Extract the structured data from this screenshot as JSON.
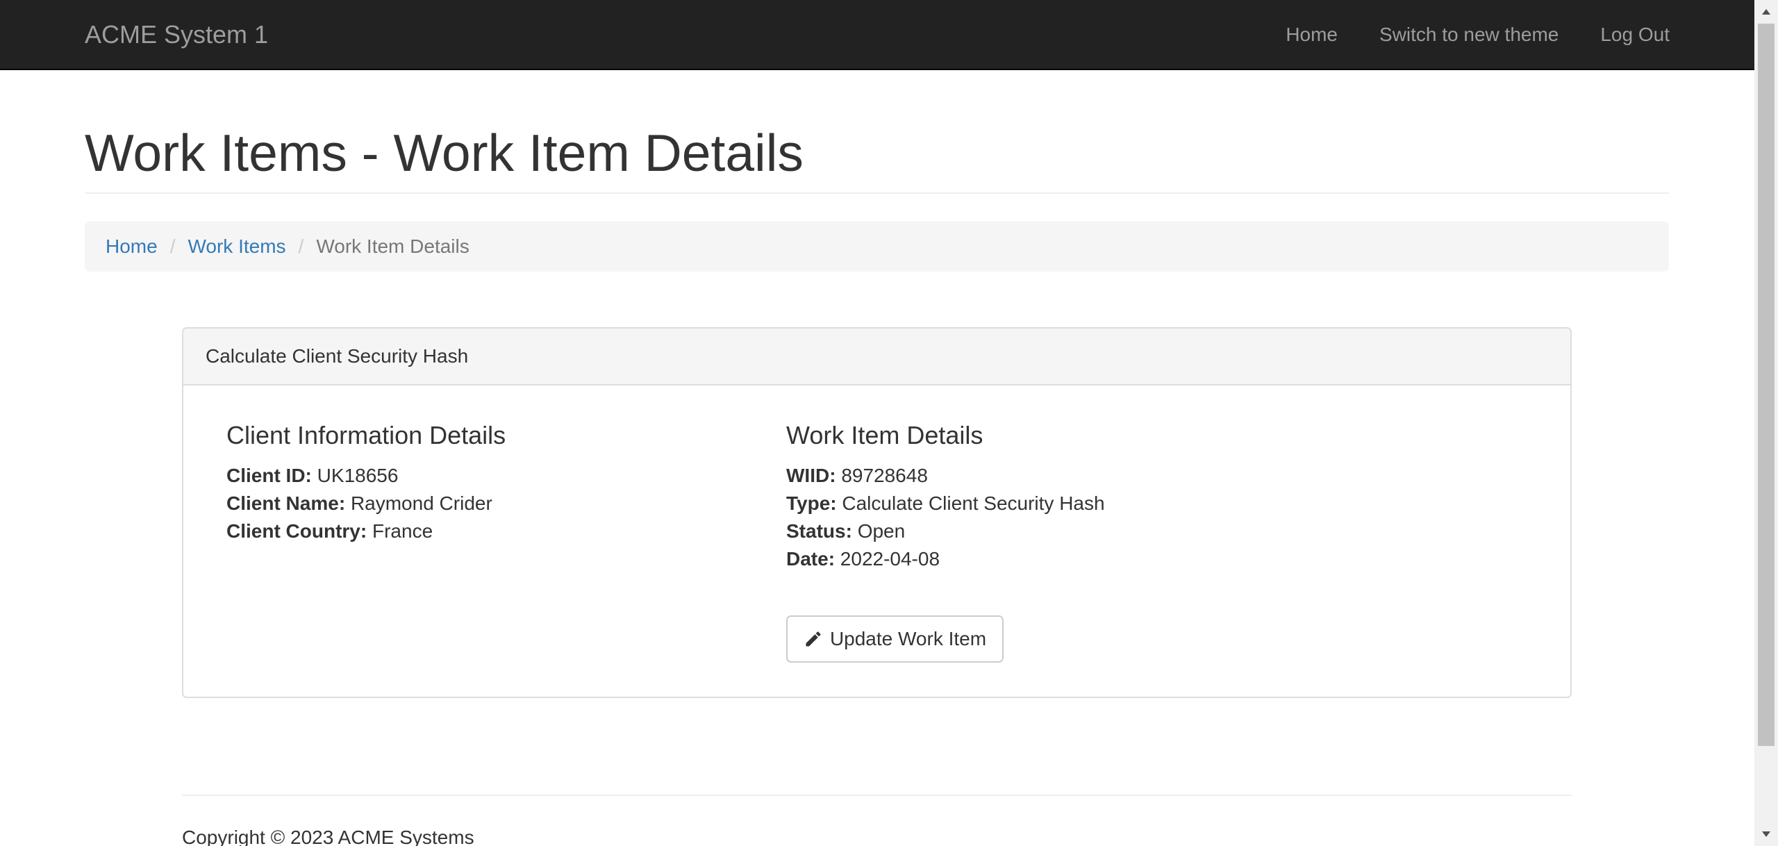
{
  "navbar": {
    "brand": "ACME System 1",
    "links": [
      "Home",
      "Switch to new theme",
      "Log Out"
    ]
  },
  "page": {
    "title": "Work Items - Work Item Details"
  },
  "breadcrumb": {
    "items": [
      "Home",
      "Work Items"
    ],
    "active": "Work Item Details"
  },
  "panel": {
    "heading": "Calculate Client Security Hash",
    "client": {
      "title": "Client Information Details",
      "fields": [
        {
          "label": "Client ID:",
          "value": "UK18656"
        },
        {
          "label": "Client Name:",
          "value": "Raymond Crider"
        },
        {
          "label": "Client Country:",
          "value": "France"
        }
      ]
    },
    "work_item": {
      "title": "Work Item Details",
      "fields": [
        {
          "label": "WIID:",
          "value": "89728648"
        },
        {
          "label": "Type:",
          "value": "Calculate Client Security Hash"
        },
        {
          "label": "Status:",
          "value": "Open"
        },
        {
          "label": "Date:",
          "value": "2022-04-08"
        }
      ]
    },
    "update_button": {
      "label": "Update Work Item",
      "icon": "pencil-icon"
    }
  },
  "footer": {
    "copyright": "Copyright © 2023 ACME Systems"
  },
  "colors": {
    "navbar_bg": "#222222",
    "nav_text": "#9d9d9d",
    "link": "#337ab7",
    "panel_heading_bg": "#f5f5f5"
  }
}
